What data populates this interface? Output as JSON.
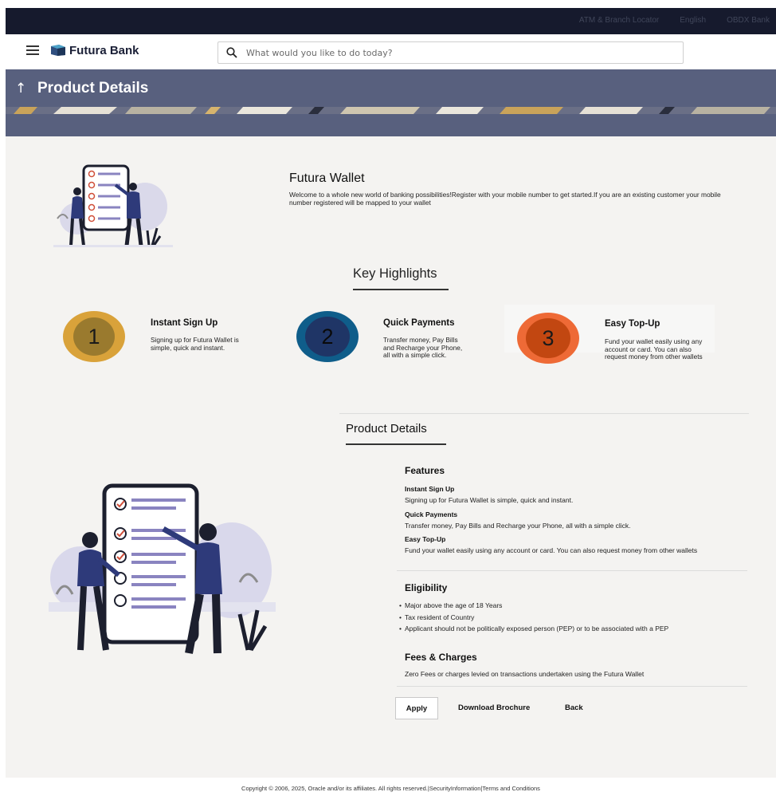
{
  "topbar": {
    "links": [
      "ATM & Branch Locator",
      "English",
      "OBDX Bank"
    ]
  },
  "header": {
    "brand": "Futura Bank",
    "search_placeholder": "What would you like to do today?"
  },
  "banner": {
    "title": "Product Details"
  },
  "wallet": {
    "name": "Futura Wallet",
    "description": "Welcome to a whole new world of banking possibilities!Register with your mobile number to get started.If you are an existing customer your mobile number registered will be mapped to your wallet"
  },
  "key_highlights": {
    "title": "Key Highlights",
    "items": [
      {
        "number": "1",
        "title": "Instant Sign Up",
        "description": "Signing up for Futura Wallet is simple, quick and instant."
      },
      {
        "number": "2",
        "title": "Quick Payments",
        "description": "Transfer money, Pay Bills and Recharge your Phone, all with a simple click."
      },
      {
        "number": "3",
        "title": "Easy Top-Up",
        "description": "Fund your wallet easily using any account or card. You can also request money from other wallets"
      }
    ]
  },
  "product_details": {
    "title": "Product Details",
    "features": {
      "heading": "Features",
      "items": [
        {
          "title": "Instant Sign Up",
          "text": "Signing up for Futura Wallet is simple, quick and instant."
        },
        {
          "title": "Quick Payments",
          "text": "Transfer money, Pay Bills and Recharge your Phone, all with a simple click."
        },
        {
          "title": "Easy Top-Up",
          "text": "Fund your wallet easily using any account or card. You can also request money from other wallets"
        }
      ]
    },
    "eligibility": {
      "heading": "Eligibility",
      "items": [
        "Major above the age of 18 Years",
        "Tax resident of Country",
        "Applicant should not be politically exposed person (PEP) or to be associated with a PEP"
      ]
    },
    "fees": {
      "heading": "Fees & Charges",
      "text": "Zero Fees or charges levied on transactions undertaken using the Futura Wallet"
    }
  },
  "actions": {
    "apply": "Apply",
    "download": "Download Brochure",
    "back": "Back"
  },
  "footer": {
    "text": "Copyright © 2006, 2025, Oracle and/or its affiliates. All rights reserved.|SecurityInformation|Terms and Conditions"
  },
  "colors": {
    "banner": "#58607e",
    "circle1": "#d9a23a",
    "circle2": "#0f5d8a",
    "circle3": "#ee6a36",
    "topbar": "#161a2d"
  },
  "icons": [
    "hamburger-icon",
    "bank-logo-icon",
    "search-icon",
    "back-arrow-icon"
  ]
}
